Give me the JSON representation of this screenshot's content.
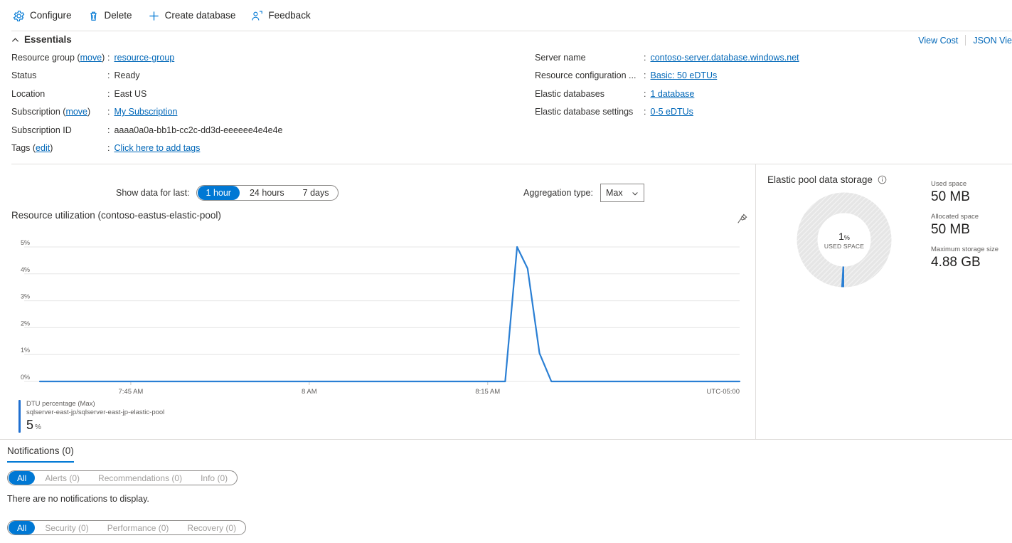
{
  "commandbar": {
    "items": [
      {
        "label": "Configure",
        "icon": "gear-icon",
        "name": "configure"
      },
      {
        "label": "Delete",
        "icon": "trash-icon",
        "name": "delete"
      },
      {
        "label": "Create database",
        "icon": "plus-icon",
        "name": "create-database"
      },
      {
        "label": "Feedback",
        "icon": "feedback-person-icon",
        "name": "feedback"
      }
    ]
  },
  "essentials": {
    "heading": "Essentials",
    "view_cost": "View Cost",
    "json_view": "JSON Vie",
    "left": [
      {
        "key": "Resource group",
        "key_link": "move",
        "value": "resource-group",
        "is_link": true
      },
      {
        "key": "Status",
        "value": "Ready",
        "is_link": false
      },
      {
        "key": "Location",
        "value": "East US",
        "is_link": false
      },
      {
        "key": "Subscription",
        "key_link": "move",
        "value": "My Subscription",
        "is_link": true
      },
      {
        "key": "Subscription ID",
        "value": "aaaa0a0a-bb1b-cc2c-dd3d-eeeeee4e4e4e",
        "is_link": false
      },
      {
        "key": "Tags",
        "key_link": "edit",
        "value": "Click here to add tags",
        "is_link": true
      }
    ],
    "right": [
      {
        "key": "Server name",
        "value": "contoso-server.database.windows.net",
        "is_link": true
      },
      {
        "key": "Resource configuration ...",
        "value": "Basic: 50 eDTUs",
        "is_link": true
      },
      {
        "key": "Elastic databases",
        "value": "1 database",
        "is_link": true
      },
      {
        "key": "Elastic database settings",
        "value": "0-5 eDTUs",
        "is_link": true
      }
    ]
  },
  "chart_panel": {
    "show_data_label": "Show data for last:",
    "time_ranges": [
      "1 hour",
      "24 hours",
      "7 days"
    ],
    "time_range_selected": "1 hour",
    "aggregation_label": "Aggregation type:",
    "aggregation_value": "Max",
    "title": "Resource utilization (contoso-eastus-elastic-pool)",
    "pin_icon": "pin-icon",
    "legend": {
      "metric": "DTU percentage (Max)",
      "resource": "sqlserver-east-jp/sqlserver-east-jp-elastic-pool",
      "value": "5",
      "unit": "%"
    }
  },
  "chart_data": {
    "type": "line",
    "title": "Resource utilization (contoso-eastus-elastic-pool)",
    "xlabel": "",
    "ylabel": "",
    "ylim": [
      0,
      5
    ],
    "ytick_labels": [
      "0%",
      "1%",
      "2%",
      "3%",
      "4%",
      "5%"
    ],
    "ytick_values": [
      0,
      1,
      2,
      3,
      4,
      5
    ],
    "xtick_labels": [
      "7:45 AM",
      "8 AM",
      "8:15 AM"
    ],
    "xtick_positions": [
      0.13,
      0.385,
      0.64
    ],
    "timezone_label": "UTC-05:00",
    "grid": true,
    "legend_position": "below",
    "line_color": "#2a7fd4",
    "series": [
      {
        "name": "DTU percentage (Max)",
        "resource": "sqlserver-east-jp/sqlserver-east-jp-elastic-pool",
        "unit": "%",
        "aggregation": "Max",
        "latest_value": 5,
        "x": [
          0.0,
          0.62,
          0.665,
          0.682,
          0.697,
          0.714,
          0.731,
          1.0
        ],
        "values": [
          0,
          0,
          0,
          5,
          4.2,
          1.05,
          0,
          0
        ]
      }
    ]
  },
  "storage_panel": {
    "title": "Elastic pool data storage",
    "info_icon": "info-icon",
    "donut": {
      "percent": "1",
      "percent_unit": "%",
      "caption": "USED SPACE",
      "used_fraction": 0.01,
      "fill_color": "#2a7fd4",
      "track_color": "#e6e6e6"
    },
    "stats": [
      {
        "label": "Used space",
        "value": "50 MB"
      },
      {
        "label": "Allocated space",
        "value": "50 MB"
      },
      {
        "label": "Maximum storage size",
        "value": "4.88 GB"
      }
    ]
  },
  "notifications": {
    "tab_label": "Notifications (0)",
    "filters_primary": [
      "All",
      "Alerts (0)",
      "Recommendations (0)",
      "Info (0)"
    ],
    "filters_primary_selected": "All",
    "empty_message": "There are no notifications to display.",
    "filters_secondary": [
      "All",
      "Security (0)",
      "Performance (0)",
      "Recovery (0)"
    ],
    "filters_secondary_selected": "All"
  }
}
